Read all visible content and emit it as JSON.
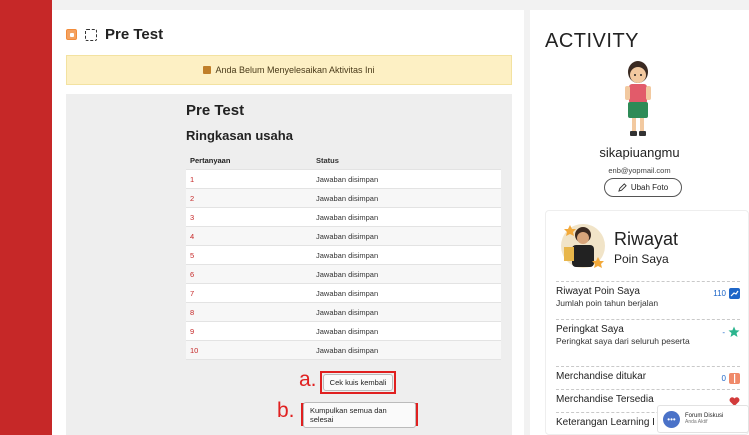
{
  "header": {
    "title": "Pre Test"
  },
  "banner": {
    "text": "Anda Belum Menyelesaikan Aktivitas Ini"
  },
  "quiz": {
    "title": "Pre Test",
    "summary_title": "Ringkasan usaha",
    "columns": [
      "Pertanyaan",
      "Status"
    ],
    "rows": [
      {
        "q": "1",
        "status": "Jawaban disimpan"
      },
      {
        "q": "2",
        "status": "Jawaban disimpan"
      },
      {
        "q": "3",
        "status": "Jawaban disimpan"
      },
      {
        "q": "4",
        "status": "Jawaban disimpan"
      },
      {
        "q": "5",
        "status": "Jawaban disimpan"
      },
      {
        "q": "6",
        "status": "Jawaban disimpan"
      },
      {
        "q": "7",
        "status": "Jawaban disimpan"
      },
      {
        "q": "8",
        "status": "Jawaban disimpan"
      },
      {
        "q": "9",
        "status": "Jawaban disimpan"
      },
      {
        "q": "10",
        "status": "Jawaban disimpan"
      }
    ],
    "btn_review": "Cek kuis kembali",
    "btn_submit": "Kumpulkan semua dan selesai",
    "mark_a": "a.",
    "mark_b": "b."
  },
  "sidebar": {
    "title": "ACTIVITY",
    "username": "sikapiuangmu",
    "email": "enb@yopmail.com",
    "edit_photo": "Ubah Foto",
    "card_title": "Riwayat",
    "card_subtitle": "Poin Saya",
    "items": [
      {
        "label": "Riwayat Poin Saya",
        "desc": "Jumlah poin tahun berjalan",
        "value": "110"
      },
      {
        "label": "Peringkat Saya",
        "desc": "Peringkat saya dari seluruh peserta",
        "value": "-"
      },
      {
        "label": "Merchandise ditukar",
        "desc": "",
        "value": "0"
      },
      {
        "label": "Merchandise Tersedia",
        "desc": "",
        "value": ""
      },
      {
        "label": "Keterangan Learning I",
        "desc": "",
        "value": ""
      }
    ]
  },
  "forum": {
    "title": "Forum Diskusi",
    "status": "Anda Aktif"
  },
  "colors": {
    "accent_red": "#c62828",
    "banner_bg": "#fdf0c4",
    "link_blue": "#1e66c8"
  }
}
